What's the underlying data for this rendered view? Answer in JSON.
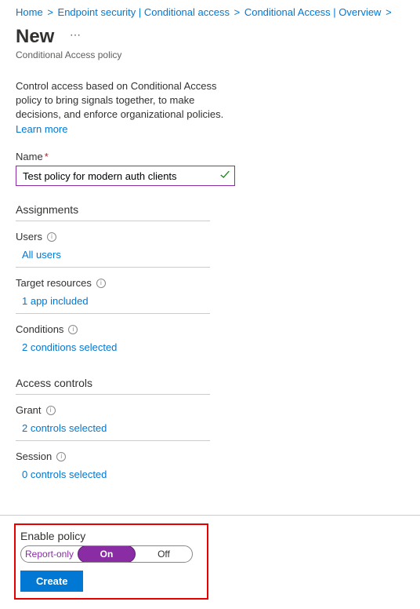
{
  "breadcrumb": {
    "items": [
      "Home",
      "Endpoint security | Conditional access",
      "Conditional Access | Overview"
    ]
  },
  "header": {
    "title": "New",
    "subtitle": "Conditional Access policy"
  },
  "description": "Control access based on Conditional Access policy to bring signals together, to make decisions, and enforce organizational policies.",
  "learnMore": "Learn more",
  "name": {
    "label": "Name",
    "value": "Test policy for modern auth clients"
  },
  "sections": {
    "assignments": {
      "title": "Assignments",
      "users": {
        "label": "Users",
        "value": "All users"
      },
      "targetResources": {
        "label": "Target resources",
        "value": "1 app included"
      },
      "conditions": {
        "label": "Conditions",
        "value": "2 conditions selected"
      }
    },
    "accessControls": {
      "title": "Access controls",
      "grant": {
        "label": "Grant",
        "value": "2 controls selected"
      },
      "session": {
        "label": "Session",
        "value": "0 controls selected"
      }
    }
  },
  "footer": {
    "enableLabel": "Enable policy",
    "options": {
      "reportOnly": "Report-only",
      "on": "On",
      "off": "Off"
    },
    "createLabel": "Create"
  }
}
